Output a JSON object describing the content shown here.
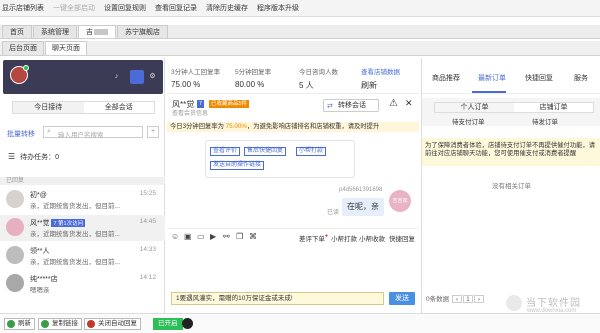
{
  "toolbar": {
    "items": [
      "显示店铺列表",
      "一键全部启动",
      "设置回复规则",
      "查看回复记录",
      "清除历史缓存",
      "程序版本升级"
    ]
  },
  "tabs_top": {
    "home": "首页",
    "system": "系统管理",
    "shop1": "吉",
    "shop2": "苏宁旗舰店"
  },
  "tabs_second": {
    "backend": "后台页面",
    "chat": "聊天页面"
  },
  "left": {
    "today": "今日接待",
    "all": "全部会话",
    "batch": "批量转移",
    "search_placeholder": "输入用户名搜索",
    "pending": "待办任务：0",
    "replied": "已回复",
    "conversations": [
      {
        "name": "初*@",
        "msg": "亲，近期统售货发出，但目前...",
        "time": "15:25"
      },
      {
        "name": "风**觉",
        "tag": "7 第1次访问",
        "msg": "亲，近期统售货发出，但目前...",
        "time": "14:45"
      },
      {
        "name": "领**人",
        "msg": "亲，近期统售货发出，但目前...",
        "time": "14:33"
      },
      {
        "name": "纯*****店",
        "msg": "嗯嗯亲",
        "time": "14:12"
      }
    ]
  },
  "footer": {
    "refresh": "刷新",
    "copy_link": "复制链接",
    "auto_reply": "关闭自动回复",
    "online": "已开启"
  },
  "stats": {
    "manual_label": "3分钟人工回复率",
    "manual_value": "75.00 %",
    "reply_label": "5分钟回复率",
    "reply_value": "80.00 %",
    "consult_label": "今日咨询人数",
    "consult_value": "5 人",
    "store_label": "查看店铺数据",
    "refresh": "刷新"
  },
  "chat": {
    "name": "风**觉",
    "tag1": "7",
    "tag2": "已收藏商品5件",
    "sub": "查看会员信息",
    "transfer": "转移会话",
    "notice_a": "今日3分钟回复率为 ",
    "notice_rate": "75.00%",
    "notice_b": "，为避免影响店铺排名和店铺权重，请及时提升",
    "quick": [
      "查看评价",
      "售后快捷回复",
      "小帮打款",
      "发送自助操作链接"
    ],
    "shop_id": "p4d5661391698",
    "bubble": "在呢，亲",
    "read": "已读",
    "avatar": "吉吉家",
    "tools_a": "差评下单",
    "tools_b": "小帮打款",
    "tools_c": "小帮收款",
    "tools_d": "快捷回复",
    "input": "1要遇风灌实，需赠的10万保证金或未成!",
    "send": "发送"
  },
  "right": {
    "tab1": "商品推荐",
    "tab2": "最新订单",
    "tab3": "快捷回复",
    "tab4": "服务",
    "personal": "个人订单",
    "store_orders": "店铺订单",
    "pending_pay": "待支付订单",
    "pending_ship": "待发订单",
    "card": "为了保障消费者体验，店铺待支付订单不再提供催付功能，请前往对应店铺聊天功能，您可使用催支付或消费者提醒",
    "empty": "没有相关订单",
    "total": "0条数据",
    "page": "1"
  },
  "watermark": {
    "cn": "当下软件园",
    "en": "www.downxia.com"
  }
}
